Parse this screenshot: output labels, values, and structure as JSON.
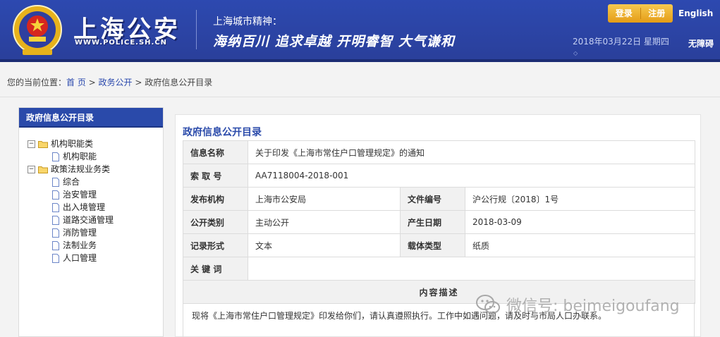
{
  "header": {
    "logo_cn": "上海公安",
    "logo_en": "WWW.POLICE.SH.CN",
    "spirit_label": "上海城市精神：",
    "spirit_slogan": "海纳百川  追求卓越  开明睿智  大气谦和",
    "login": "登录",
    "register": "注册",
    "language": "English",
    "date": "2018年03月22日 星期四",
    "accessibility": "无障碍",
    "colors": {
      "primary": "#2d49b0",
      "accent": "#e59d17"
    }
  },
  "breadcrumb": {
    "prefix": "您的当前位置：",
    "home": "首 页",
    "sep1": " > ",
    "level1": "政务公开",
    "sep2": " > ",
    "current": "政府信息公开目录"
  },
  "sidebar": {
    "title": "政府信息公开目录",
    "groups": [
      {
        "label": "机构职能类",
        "toggle": "−",
        "items": [
          "机构职能"
        ]
      },
      {
        "label": "政策法规业务类",
        "toggle": "−",
        "items": [
          "综合",
          "治安管理",
          "出入境管理",
          "道路交通管理",
          "消防管理",
          "法制业务",
          "人口管理"
        ]
      }
    ]
  },
  "main": {
    "title": "政府信息公开目录",
    "rows": {
      "info_name_label": "信息名称",
      "info_name_value": "关于印发《上海市常住户口管理规定》的通知",
      "index_label": "索 取 号",
      "index_value": "AA7118004-2018-001",
      "org_label": "发布机构",
      "org_value": "上海市公安局",
      "doc_no_label": "文件编号",
      "doc_no_value": "沪公行规〔2018〕1号",
      "category_label": "公开类别",
      "category_value": "主动公开",
      "date_label": "产生日期",
      "date_value": "2018-03-09",
      "record_label": "记录形式",
      "record_value": "文本",
      "carrier_label": "载体类型",
      "carrier_value": "纸质",
      "keywords_label": "关 键 词",
      "keywords_value": ""
    },
    "desc_header": "内容描述",
    "desc_body": "现将《上海市常住户口管理规定》印发给你们，请认真遵照执行。工作中如遇问题，请及时与市局人口办联系。"
  },
  "watermark": {
    "text": "微信号: beimeigoufang",
    "icon": "wechat-icon"
  }
}
